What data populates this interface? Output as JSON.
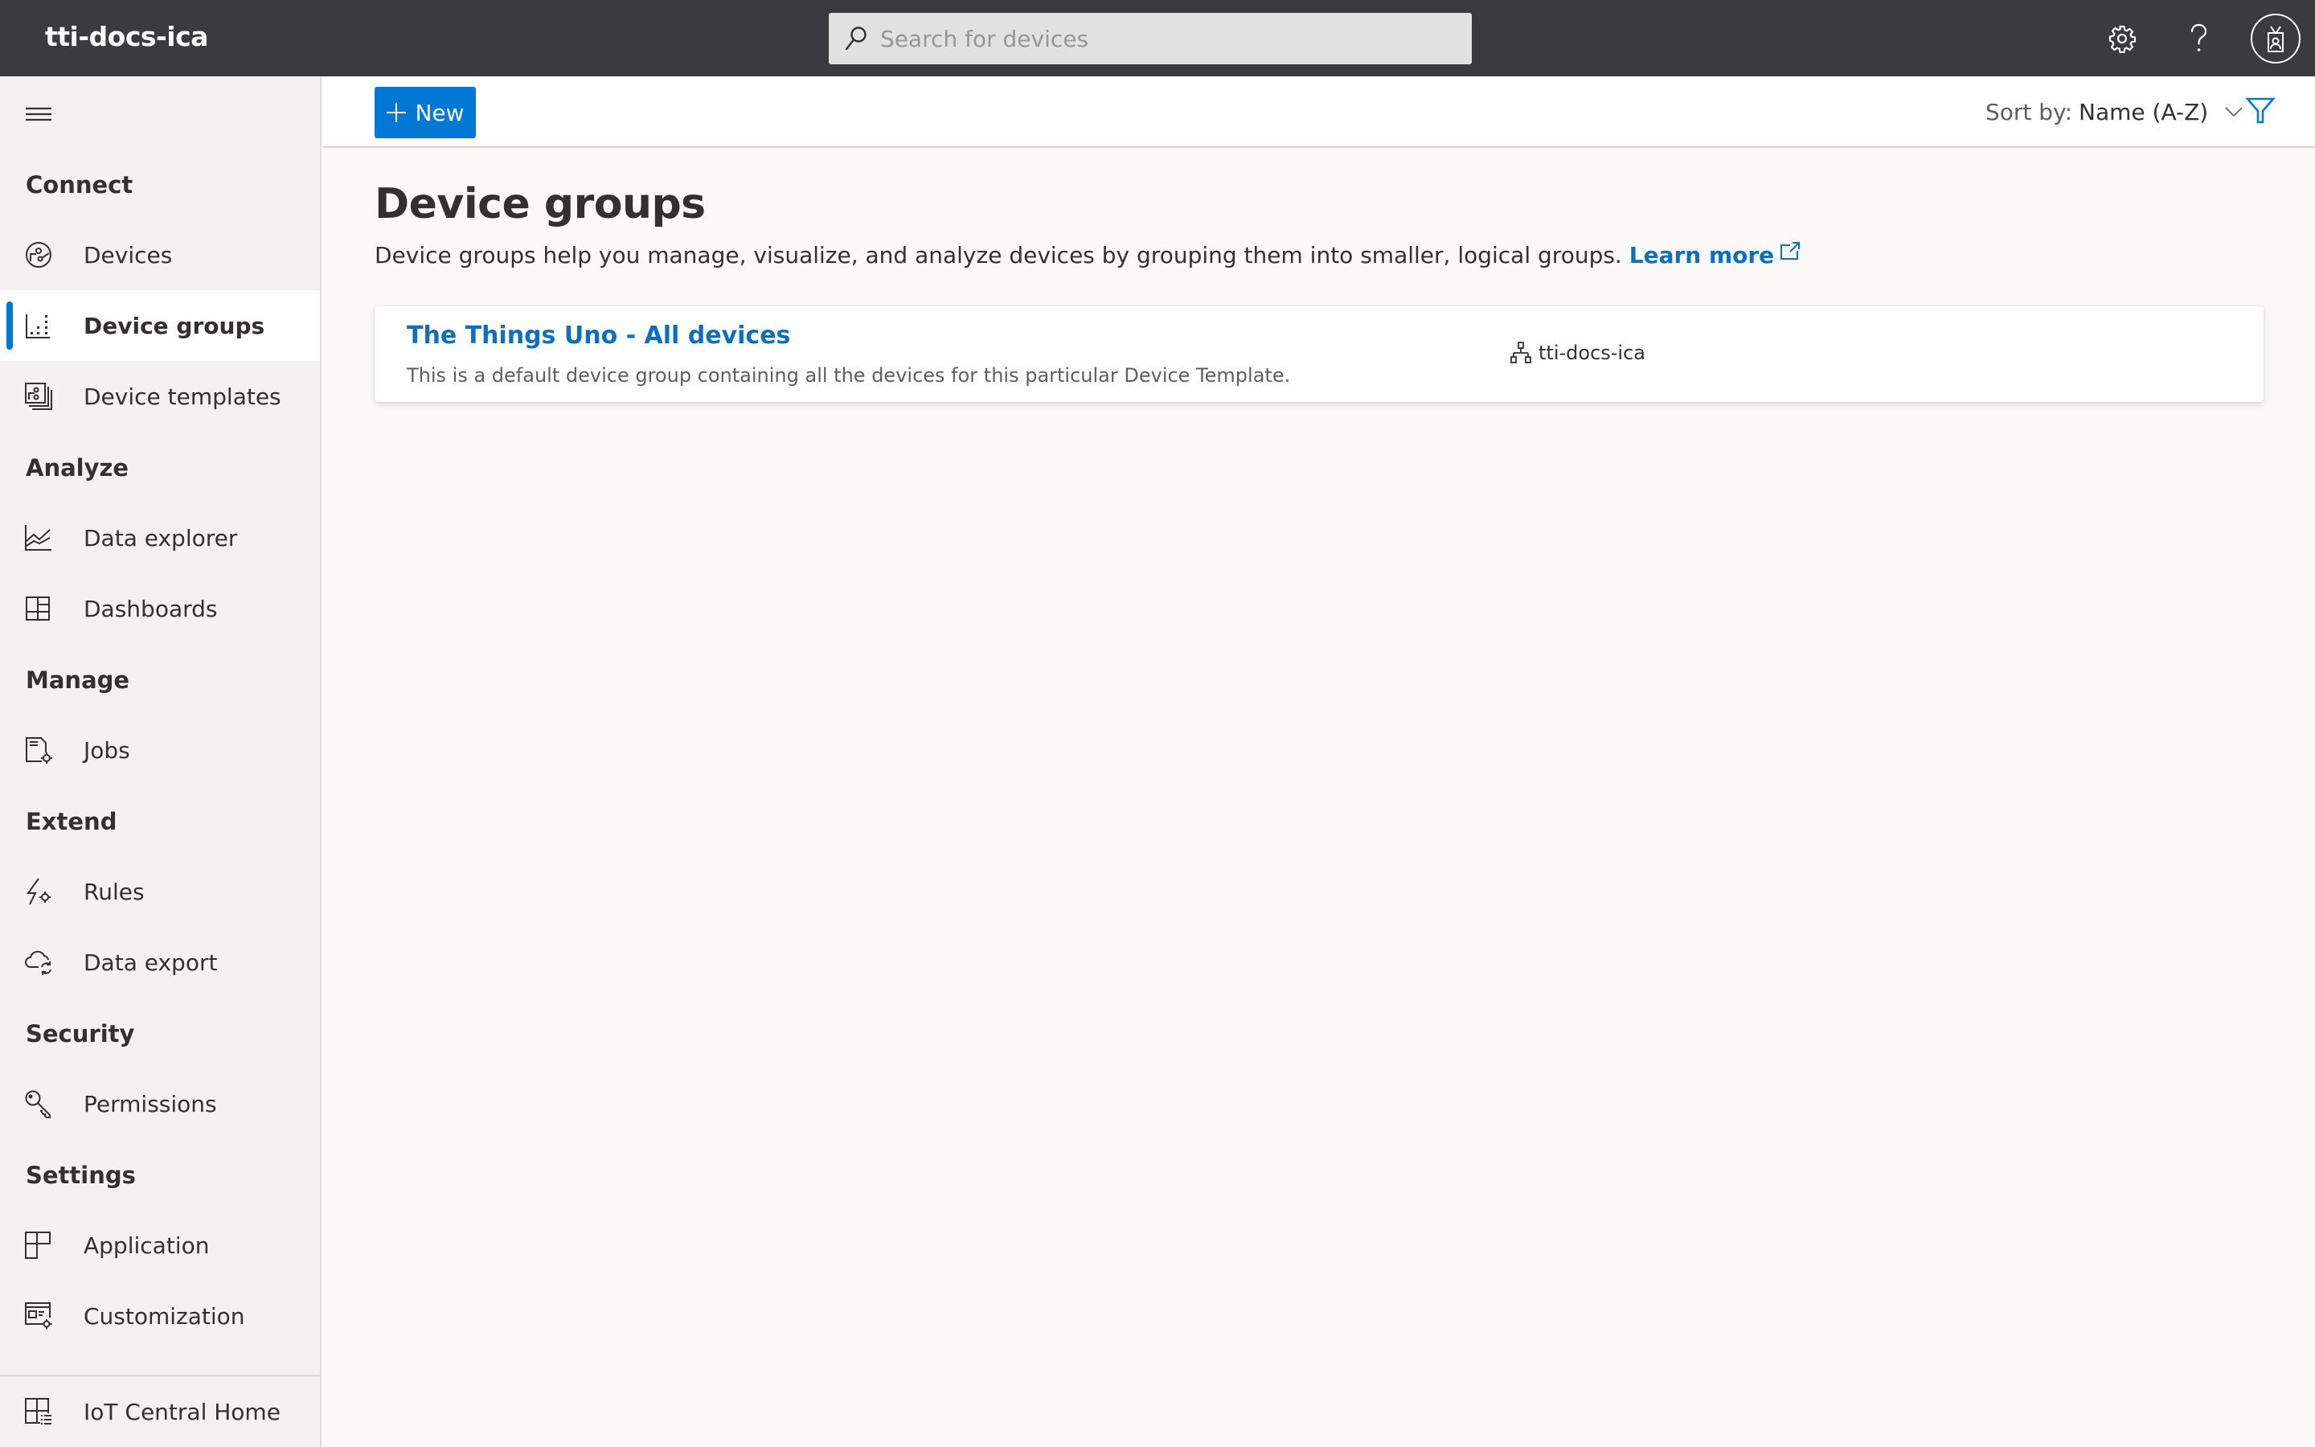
{
  "header": {
    "app_title": "tti-docs-ica",
    "search": {
      "placeholder": "Search for devices",
      "value": "",
      "icon": "search-icon"
    },
    "actions": [
      {
        "name": "settings",
        "icon": "gear-icon"
      },
      {
        "name": "help",
        "icon": "help-icon"
      },
      {
        "name": "account",
        "icon": "avatar-badge-icon"
      }
    ]
  },
  "sidebar": {
    "menu_icon": "hamburger-icon",
    "sections": [
      {
        "label": "Connect",
        "items": [
          {
            "label": "Devices",
            "icon": "devices-icon",
            "active": false
          },
          {
            "label": "Device groups",
            "icon": "device-groups-icon",
            "active": true
          },
          {
            "label": "Device templates",
            "icon": "device-templates-icon",
            "active": false
          }
        ]
      },
      {
        "label": "Analyze",
        "items": [
          {
            "label": "Data explorer",
            "icon": "chart-line-icon",
            "active": false
          },
          {
            "label": "Dashboards",
            "icon": "dashboard-icon",
            "active": false
          }
        ]
      },
      {
        "label": "Manage",
        "items": [
          {
            "label": "Jobs",
            "icon": "jobs-icon",
            "active": false
          }
        ]
      },
      {
        "label": "Extend",
        "items": [
          {
            "label": "Rules",
            "icon": "rules-icon",
            "active": false
          },
          {
            "label": "Data export",
            "icon": "cloud-sync-icon",
            "active": false
          }
        ]
      },
      {
        "label": "Security",
        "items": [
          {
            "label": "Permissions",
            "icon": "key-icon",
            "active": false
          }
        ]
      },
      {
        "label": "Settings",
        "items": [
          {
            "label": "Application",
            "icon": "application-icon",
            "active": false
          },
          {
            "label": "Customization",
            "icon": "customization-icon",
            "active": false
          }
        ]
      }
    ],
    "footer_item": {
      "label": "IoT Central Home",
      "icon": "iot-home-icon"
    }
  },
  "toolbar": {
    "new_label": "New",
    "sort_prefix": "Sort by:",
    "sort_value": "Name (A-Z)",
    "filter_icon": "filter-icon"
  },
  "main": {
    "title": "Device groups",
    "description": "Device groups help you manage, visualize, and analyze devices by grouping them into smaller, logical groups.",
    "learn_more": "Learn more",
    "groups": [
      {
        "name": "The Things Uno - All devices",
        "description": "This is a default device group containing all the devices for this particular Device Template.",
        "organization": "tti-docs-ica"
      }
    ]
  },
  "colors": {
    "header_bg": "#3b3a3f",
    "accent": "#0078d4",
    "link": "#106ebe",
    "sidebar_bg": "#f3f2f1",
    "page_bg": "#faf9f8"
  }
}
